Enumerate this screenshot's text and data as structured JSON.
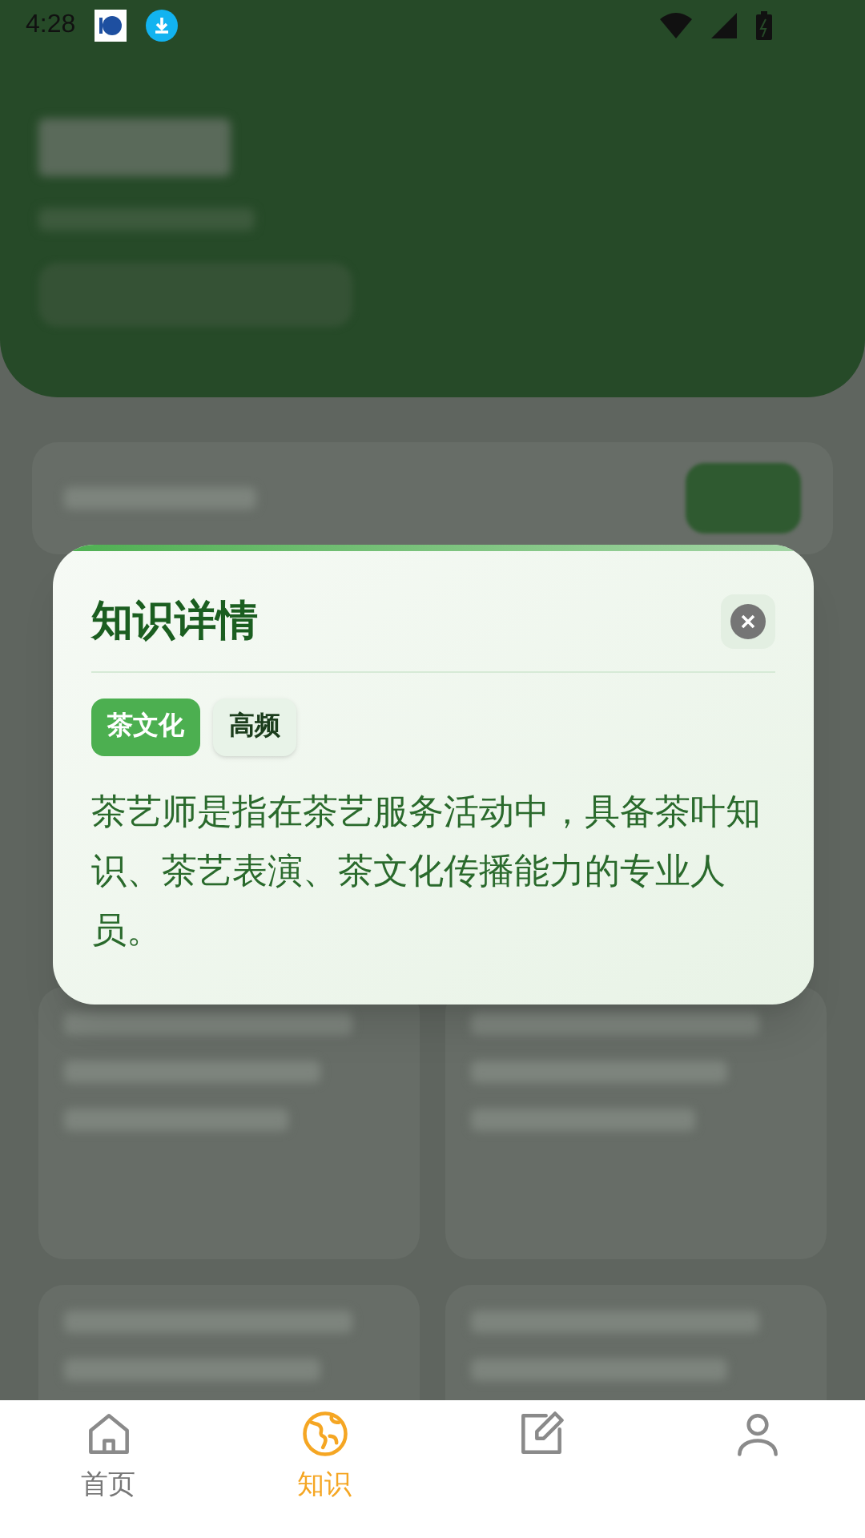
{
  "status_bar": {
    "time": "4:28"
  },
  "dialog": {
    "title": "知识详情",
    "tags": [
      {
        "label": "茶文化",
        "kind": "category"
      },
      {
        "label": "高频",
        "kind": "frequency"
      }
    ],
    "body": "茶艺师是指在茶艺服务活动中，具备茶叶知识、茶艺表演、茶文化传播能力的专业人员。"
  },
  "nav": [
    {
      "label": "首页",
      "kind": "home",
      "selected": false
    },
    {
      "label": "知识",
      "kind": "globe",
      "selected": true
    },
    {
      "kind": "edit",
      "selected": false
    },
    {
      "kind": "user",
      "selected": false
    }
  ]
}
